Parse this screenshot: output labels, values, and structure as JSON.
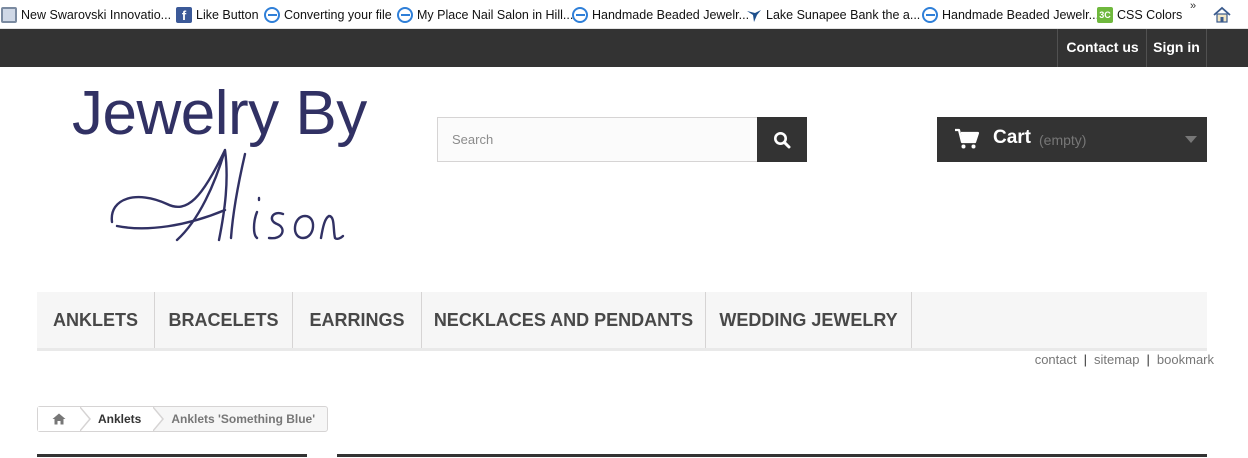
{
  "favorites": [
    {
      "label": "New Swarovski Innovatio...",
      "icon": "swarovski-icon"
    },
    {
      "label": "Like Button",
      "icon": "facebook-icon"
    },
    {
      "label": "Converting your file",
      "icon": "ie-page-icon"
    },
    {
      "label": "My Place Nail Salon in Hill...",
      "icon": "ie-page-icon"
    },
    {
      "label": "Handmade Beaded Jewelr...",
      "icon": "ie-page-icon"
    },
    {
      "label": "Lake Sunapee Bank  the a...",
      "icon": "bird-icon"
    },
    {
      "label": "Handmade Beaded Jewelr...",
      "icon": "ie-page-icon"
    },
    {
      "label": "CSS Colors",
      "icon": "css-icon"
    }
  ],
  "favorites_more": "»",
  "topnav": {
    "contact": "Contact us",
    "signin": "Sign in"
  },
  "logo": {
    "line1": "Jewelry By",
    "line2": "Alison"
  },
  "search": {
    "placeholder": "Search",
    "value": ""
  },
  "cart": {
    "label": "Cart",
    "status": "(empty)"
  },
  "menu": [
    "ANKLETS",
    "BRACELETS",
    "EARRINGS",
    "NECKLACES AND PENDANTS",
    "WEDDING JEWELRY"
  ],
  "links": [
    "contact",
    "sitemap",
    "bookmark"
  ],
  "breadcrumb": {
    "parent": "Anklets",
    "current": "Anklets 'Something Blue'"
  },
  "colors": {
    "dark": "#333333",
    "logo": "#313164",
    "menu_bg": "#f6f6f6",
    "muted": "#777777"
  }
}
